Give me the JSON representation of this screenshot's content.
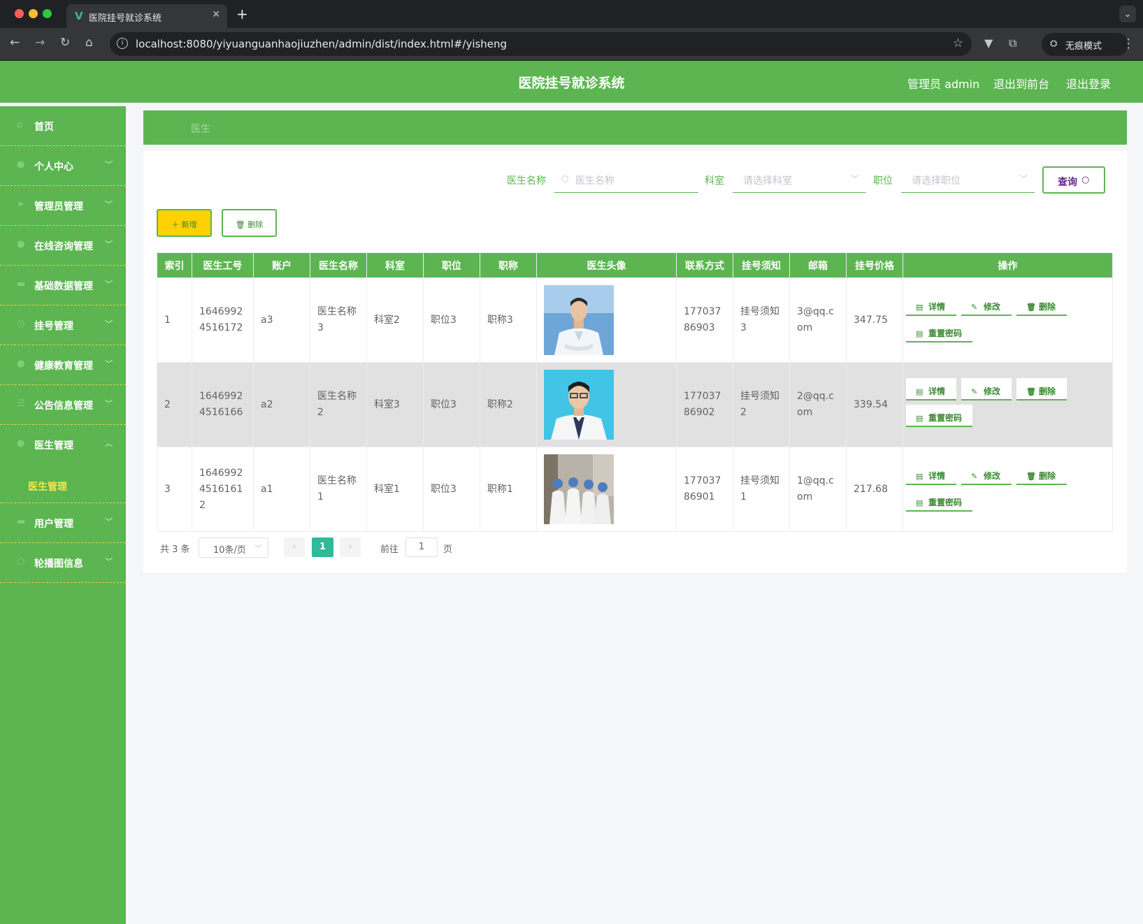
{
  "browser": {
    "tab_title": "医院挂号就诊系统",
    "url": "localhost:8080/yiyuanguanhaojiuzhen/admin/dist/index.html#/yisheng",
    "incognito_label": "无痕模式"
  },
  "header": {
    "title": "医院挂号就诊系统",
    "user": "管理员 admin",
    "to_front": "退出到前台",
    "logout": "退出登录"
  },
  "sidebar": {
    "items": [
      {
        "label": "首页",
        "icon": "home-icon",
        "has_arrow": false
      },
      {
        "label": "个人中心",
        "icon": "user-icon",
        "has_arrow": true
      },
      {
        "label": "管理员管理",
        "icon": "send-icon",
        "has_arrow": true
      },
      {
        "label": "在线咨询管理",
        "icon": "user-icon",
        "has_arrow": true
      },
      {
        "label": "基础数据管理",
        "icon": "monitor-icon",
        "has_arrow": true
      },
      {
        "label": "挂号管理",
        "icon": "clock-icon",
        "has_arrow": true
      },
      {
        "label": "健康教育管理",
        "icon": "user-icon",
        "has_arrow": true
      },
      {
        "label": "公告信息管理",
        "icon": "list-icon",
        "has_arrow": true
      },
      {
        "label": "医生管理",
        "icon": "user-icon",
        "has_arrow": true,
        "expanded": true
      },
      {
        "label": "用户管理",
        "icon": "monitor-icon",
        "has_arrow": true
      },
      {
        "label": "轮播图信息",
        "icon": "circle-icon",
        "has_arrow": true
      }
    ],
    "submenu_active": "医生管理"
  },
  "breadcrumb": "医生",
  "search": {
    "name_label": "医生名称",
    "name_placeholder": "医生名称",
    "dept_label": "科室",
    "dept_placeholder": "请选择科室",
    "position_label": "职位",
    "position_placeholder": "请选择职位",
    "query_label": "查询"
  },
  "actions": {
    "add": "新增",
    "delete": "删除"
  },
  "table": {
    "headers": [
      "索引",
      "医生工号",
      "账户",
      "医生名称",
      "科室",
      "职位",
      "职称",
      "医生头像",
      "联系方式",
      "挂号须知",
      "邮箱",
      "挂号价格",
      "操作"
    ],
    "rows": [
      {
        "index": "1",
        "code": "16469924516172",
        "account": "a3",
        "name": "医生名称3",
        "dept": "科室2",
        "position": "职位3",
        "title": "职称3",
        "phone": "17703786903",
        "notice": "挂号须知3",
        "email": "3@qq.com",
        "price": "347.75"
      },
      {
        "index": "2",
        "code": "16469924516166",
        "account": "a2",
        "name": "医生名称2",
        "dept": "科室3",
        "position": "职位3",
        "title": "职称2",
        "phone": "17703786902",
        "notice": "挂号须知2",
        "email": "2@qq.com",
        "price": "339.54"
      },
      {
        "index": "3",
        "code": "164699245161612",
        "account": "a1",
        "name": "医生名称1",
        "dept": "科室1",
        "position": "职位3",
        "title": "职称1",
        "phone": "17703786901",
        "notice": "挂号须知1",
        "email": "1@qq.com",
        "price": "217.68"
      }
    ],
    "op_labels": {
      "detail": "详情",
      "edit": "修改",
      "delete": "删除",
      "reset": "重置密码"
    }
  },
  "pagination": {
    "total": "共 3 条",
    "page_size": "10条/页",
    "current": "1",
    "goto_label": "前往",
    "goto_value": "1",
    "page_suffix": "页"
  },
  "colors": {
    "primary_green": "#5cb551",
    "accent_yellow": "#fdd106",
    "pager_active": "#2dbb9a"
  }
}
